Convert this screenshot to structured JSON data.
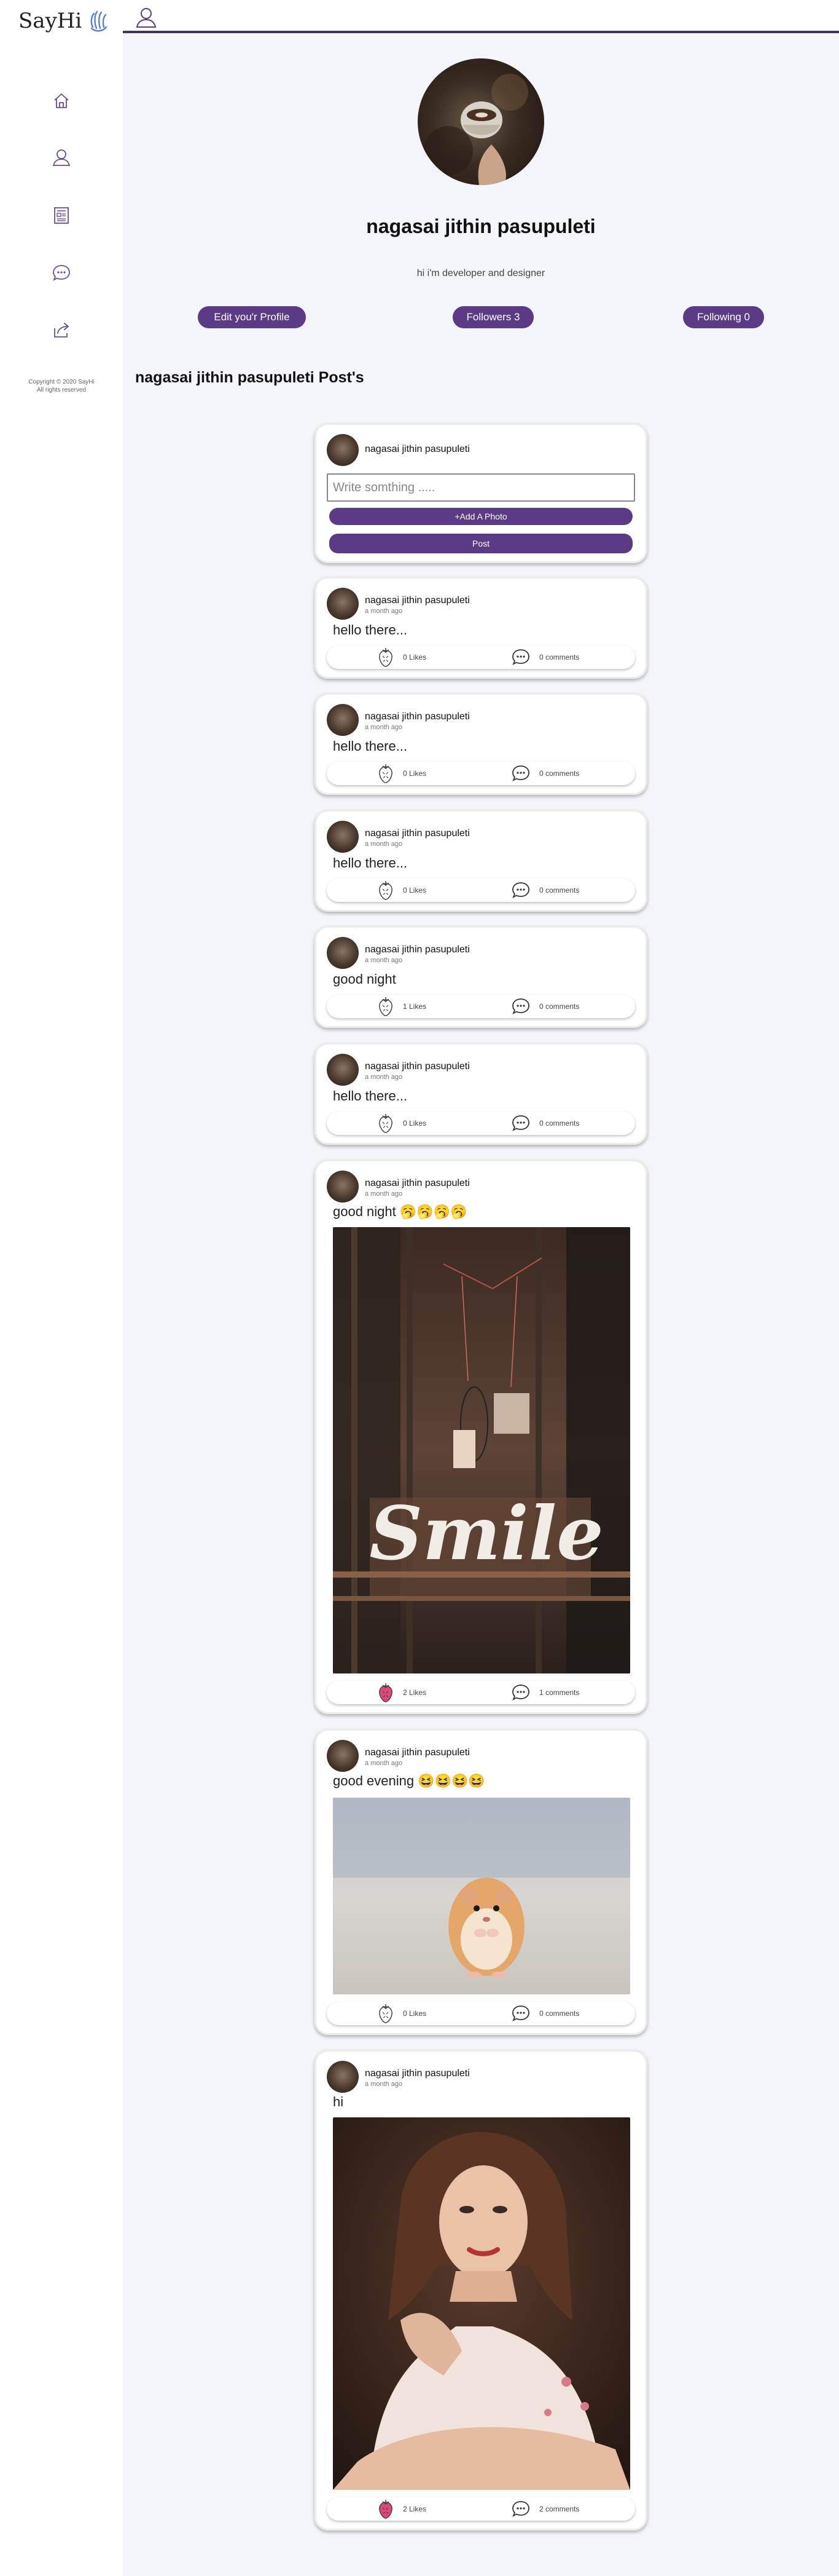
{
  "app": {
    "logo_text": "SayHi"
  },
  "sidebar": {
    "items": [
      {
        "icon": "home-icon"
      },
      {
        "icon": "user-icon"
      },
      {
        "icon": "news-icon"
      },
      {
        "icon": "chat-icon"
      },
      {
        "icon": "share-icon"
      }
    ],
    "copyright_line1": "Copyright © 2020 SayHi",
    "copyright_line2": "All rights reserved"
  },
  "topbar": {
    "icon": "user-icon"
  },
  "profile": {
    "name": "nagasai jithin pasupuleti",
    "bio": "hi i'm developer and designer",
    "edit_label": "Edit you'r Profile",
    "followers_label": "Followers 3",
    "following_label": "Following 0"
  },
  "posts_title": "nagasai jithin pasupuleti Post's",
  "composer": {
    "username": "nagasai jithin pasupuleti",
    "placeholder": "Write somthing .....",
    "add_photo_label": "+Add A Photo",
    "post_label": "Post"
  },
  "posts": [
    {
      "username": "nagasai jithin pasupuleti",
      "time": "a month ago",
      "text": "hello there...",
      "likes": "0 Likes",
      "comments": "0 comments",
      "liked": false
    },
    {
      "username": "nagasai jithin pasupuleti",
      "time": "a month ago",
      "text": "hello there...",
      "likes": "0 Likes",
      "comments": "0 comments",
      "liked": false
    },
    {
      "username": "nagasai jithin pasupuleti",
      "time": "a month ago",
      "text": "hello there...",
      "likes": "0 Likes",
      "comments": "0 comments",
      "liked": false
    },
    {
      "username": "nagasai jithin pasupuleti",
      "time": "a month ago",
      "text": "good night",
      "likes": "1 Likes",
      "comments": "0 comments",
      "liked": false
    },
    {
      "username": "nagasai jithin pasupuleti",
      "time": "a month ago",
      "text": "hello there...",
      "likes": "0 Likes",
      "comments": "0 comments",
      "liked": false
    },
    {
      "username": "nagasai jithin pasupuleti",
      "time": "a month ago",
      "text": "good night 🥱🥱🥱🥱",
      "likes": "2 Likes",
      "comments": "1 comments",
      "liked": true,
      "image": "smile-sign-photo"
    },
    {
      "username": "nagasai jithin pasupuleti",
      "time": "a month ago",
      "text": "good evening 😆😆😆😆",
      "likes": "0 Likes",
      "comments": "0 comments",
      "liked": false,
      "image": "hamster-photo"
    },
    {
      "username": "nagasai jithin pasupuleti",
      "time": "a month ago",
      "text": "hi",
      "likes": "2 Likes",
      "comments": "2 comments",
      "liked": true,
      "image": "woman-portrait-photo"
    }
  ],
  "colors": {
    "accent": "#5b3a86",
    "topbar_line": "#3d3659",
    "like_active": "#e0457b",
    "background": "#f4f5fa"
  }
}
